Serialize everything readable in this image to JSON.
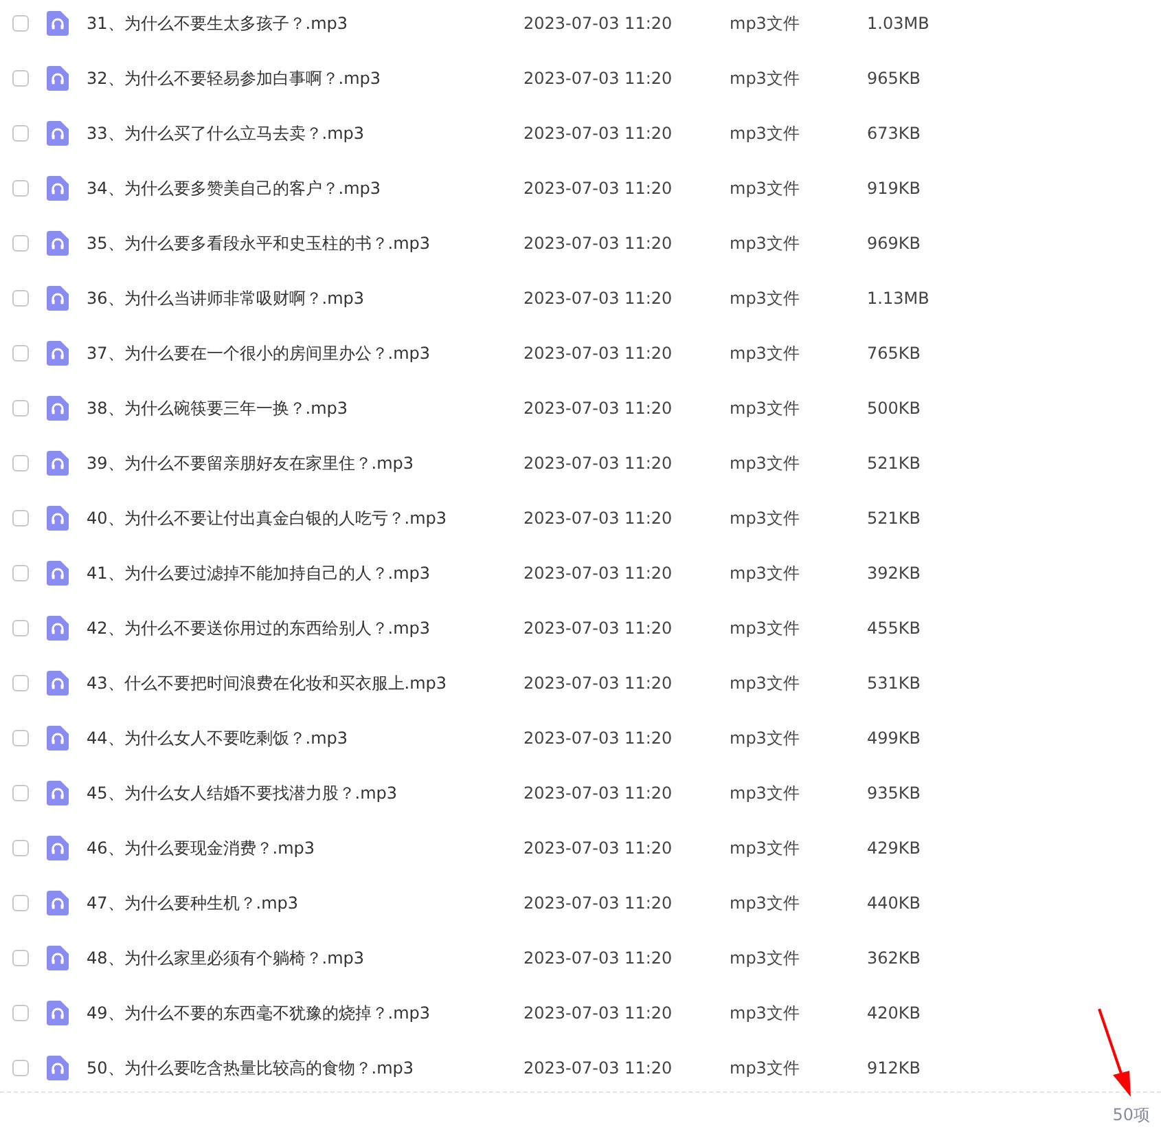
{
  "files": [
    {
      "name": "31、为什么不要生太多孩子？.mp3",
      "checked": false,
      "modified": "2023-07-03 11:20",
      "type": "mp3文件",
      "size": "1.03MB"
    },
    {
      "name": "32、为什么不要轻易参加白事啊？.mp3",
      "checked": false,
      "modified": "2023-07-03 11:20",
      "type": "mp3文件",
      "size": "965KB"
    },
    {
      "name": "33、为什么买了什么立马去卖？.mp3",
      "checked": false,
      "modified": "2023-07-03 11:20",
      "type": "mp3文件",
      "size": "673KB"
    },
    {
      "name": "34、为什么要多赞美自己的客户？.mp3",
      "checked": false,
      "modified": "2023-07-03 11:20",
      "type": "mp3文件",
      "size": "919KB"
    },
    {
      "name": "35、为什么要多看段永平和史玉柱的书？.mp3",
      "checked": false,
      "modified": "2023-07-03 11:20",
      "type": "mp3文件",
      "size": "969KB"
    },
    {
      "name": "36、为什么当讲师非常吸财啊？.mp3",
      "checked": false,
      "modified": "2023-07-03 11:20",
      "type": "mp3文件",
      "size": "1.13MB"
    },
    {
      "name": "37、为什么要在一个很小的房间里办公？.mp3",
      "checked": false,
      "modified": "2023-07-03 11:20",
      "type": "mp3文件",
      "size": "765KB"
    },
    {
      "name": "38、为什么碗筷要三年一换？.mp3",
      "checked": false,
      "modified": "2023-07-03 11:20",
      "type": "mp3文件",
      "size": "500KB"
    },
    {
      "name": "39、为什么不要留亲朋好友在家里住？.mp3",
      "checked": false,
      "modified": "2023-07-03 11:20",
      "type": "mp3文件",
      "size": "521KB"
    },
    {
      "name": "40、为什么不要让付出真金白银的人吃亏？.mp3",
      "checked": false,
      "modified": "2023-07-03 11:20",
      "type": "mp3文件",
      "size": "521KB"
    },
    {
      "name": "41、为什么要过滤掉不能加持自己的人？.mp3",
      "checked": false,
      "modified": "2023-07-03 11:20",
      "type": "mp3文件",
      "size": "392KB"
    },
    {
      "name": "42、为什么不要送你用过的东西给别人？.mp3",
      "checked": false,
      "modified": "2023-07-03 11:20",
      "type": "mp3文件",
      "size": "455KB"
    },
    {
      "name": "43、什么不要把时间浪费在化妆和买衣服上.mp3",
      "checked": false,
      "modified": "2023-07-03 11:20",
      "type": "mp3文件",
      "size": "531KB"
    },
    {
      "name": "44、为什么女人不要吃剩饭？.mp3",
      "checked": false,
      "modified": "2023-07-03 11:20",
      "type": "mp3文件",
      "size": "499KB"
    },
    {
      "name": "45、为什么女人结婚不要找潜力股？.mp3",
      "checked": false,
      "modified": "2023-07-03 11:20",
      "type": "mp3文件",
      "size": "935KB"
    },
    {
      "name": "46、为什么要现金消费？.mp3",
      "checked": false,
      "modified": "2023-07-03 11:20",
      "type": "mp3文件",
      "size": "429KB"
    },
    {
      "name": "47、为什么要种生机？.mp3",
      "checked": false,
      "modified": "2023-07-03 11:20",
      "type": "mp3文件",
      "size": "440KB"
    },
    {
      "name": "48、为什么家里必须有个躺椅？.mp3",
      "checked": false,
      "modified": "2023-07-03 11:20",
      "type": "mp3文件",
      "size": "362KB"
    },
    {
      "name": "49、为什么不要的东西毫不犹豫的烧掉？.mp3",
      "checked": false,
      "modified": "2023-07-03 11:20",
      "type": "mp3文件",
      "size": "420KB"
    },
    {
      "name": "50、为什么要吃含热量比较高的食物？.mp3",
      "checked": false,
      "modified": "2023-07-03 11:20",
      "type": "mp3文件",
      "size": "912KB"
    }
  ],
  "footer": {
    "count": "50项"
  }
}
